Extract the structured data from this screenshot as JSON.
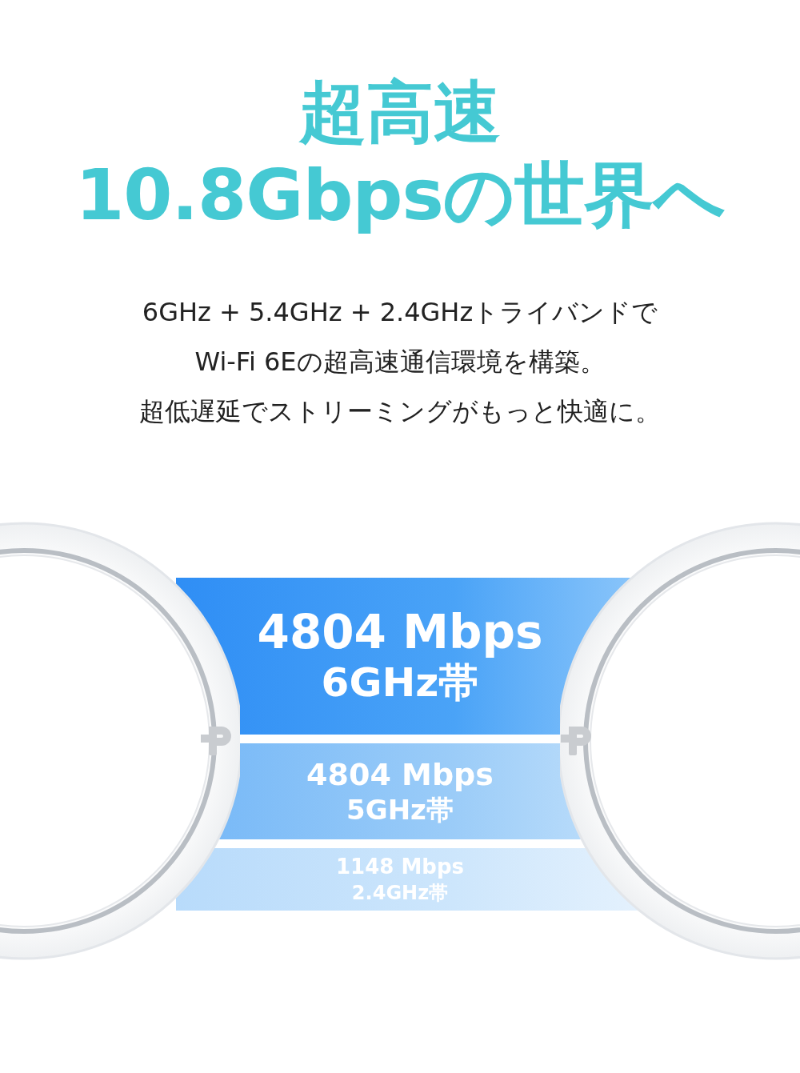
{
  "headline": {
    "line_1": "超高速",
    "line_2": "10.8Gbpsの世界へ"
  },
  "description": [
    "6GHz + 5.4GHz + 2.4GHzトライバンドで",
    "Wi-Fi 6Eの超高速通信環境を構築。",
    "超低遅延でストリーミングがもっと快適に。"
  ],
  "bands": [
    {
      "kind": "large",
      "speed": "4804 Mbps",
      "band": "6GHz帯"
    },
    {
      "kind": "medium",
      "speed": "4804 Mbps",
      "band": "5GHz帯"
    },
    {
      "kind": "small",
      "speed": "1148 Mbps",
      "band": "2.4GHz帯"
    }
  ]
}
